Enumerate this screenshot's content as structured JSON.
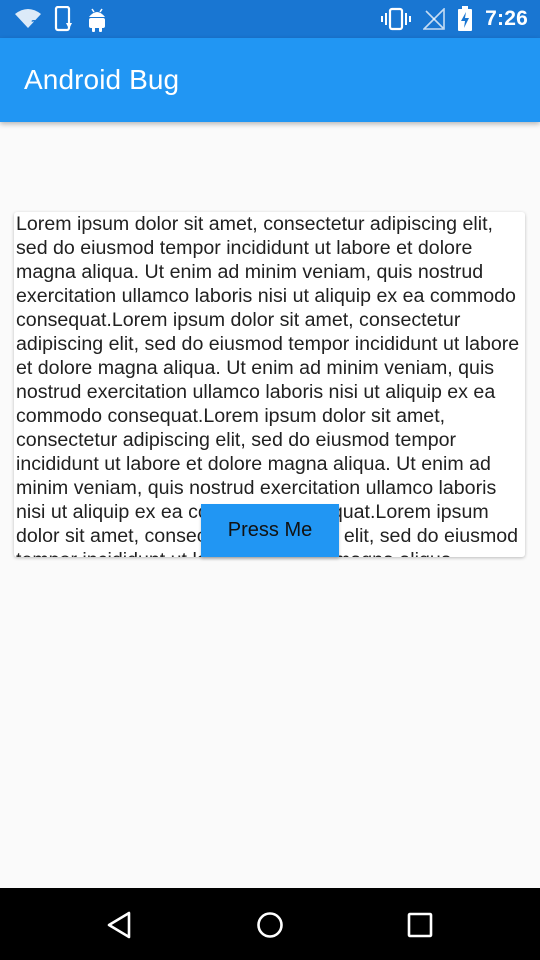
{
  "status_bar": {
    "time": "7:26",
    "icons": [
      "wifi-question-icon",
      "phone-alert-icon",
      "android-icon",
      "vibrate-icon",
      "signal-off-icon",
      "battery-charging-icon"
    ]
  },
  "app_bar": {
    "title": "Android Bug"
  },
  "card": {
    "text": "Lorem ipsum dolor sit amet, consectetur adipiscing elit, sed do eiusmod tempor incididunt ut labore et dolore magna aliqua. Ut enim ad minim veniam, quis nostrud exercitation ullamco laboris nisi ut aliquip ex ea commodo consequat.Lorem ipsum dolor sit amet, consectetur adipiscing elit, sed do eiusmod tempor incididunt ut labore et dolore magna aliqua. Ut enim ad minim veniam, quis nostrud exercitation ullamco laboris nisi ut aliquip ex ea commodo consequat.Lorem ipsum dolor sit amet, consectetur adipiscing elit, sed do eiusmod tempor incididunt ut labore et dolore magna aliqua. Ut enim ad minim veniam, quis nostrud exercitation ullamco laboris nisi ut aliquip ex ea commodo consequat.Lorem ipsum dolor sit amet, consectetur adipiscing elit, sed do eiusmod tempor incididunt ut labore et dolore magna aliqua."
  },
  "button": {
    "label": "Press Me"
  },
  "nav_bar": {
    "icons": [
      "back-icon",
      "home-icon",
      "recents-icon"
    ]
  },
  "colors": {
    "status_bar": "#1976d2",
    "app_bar": "#2196f3",
    "button": "#2196f3",
    "background": "#fafafa"
  }
}
